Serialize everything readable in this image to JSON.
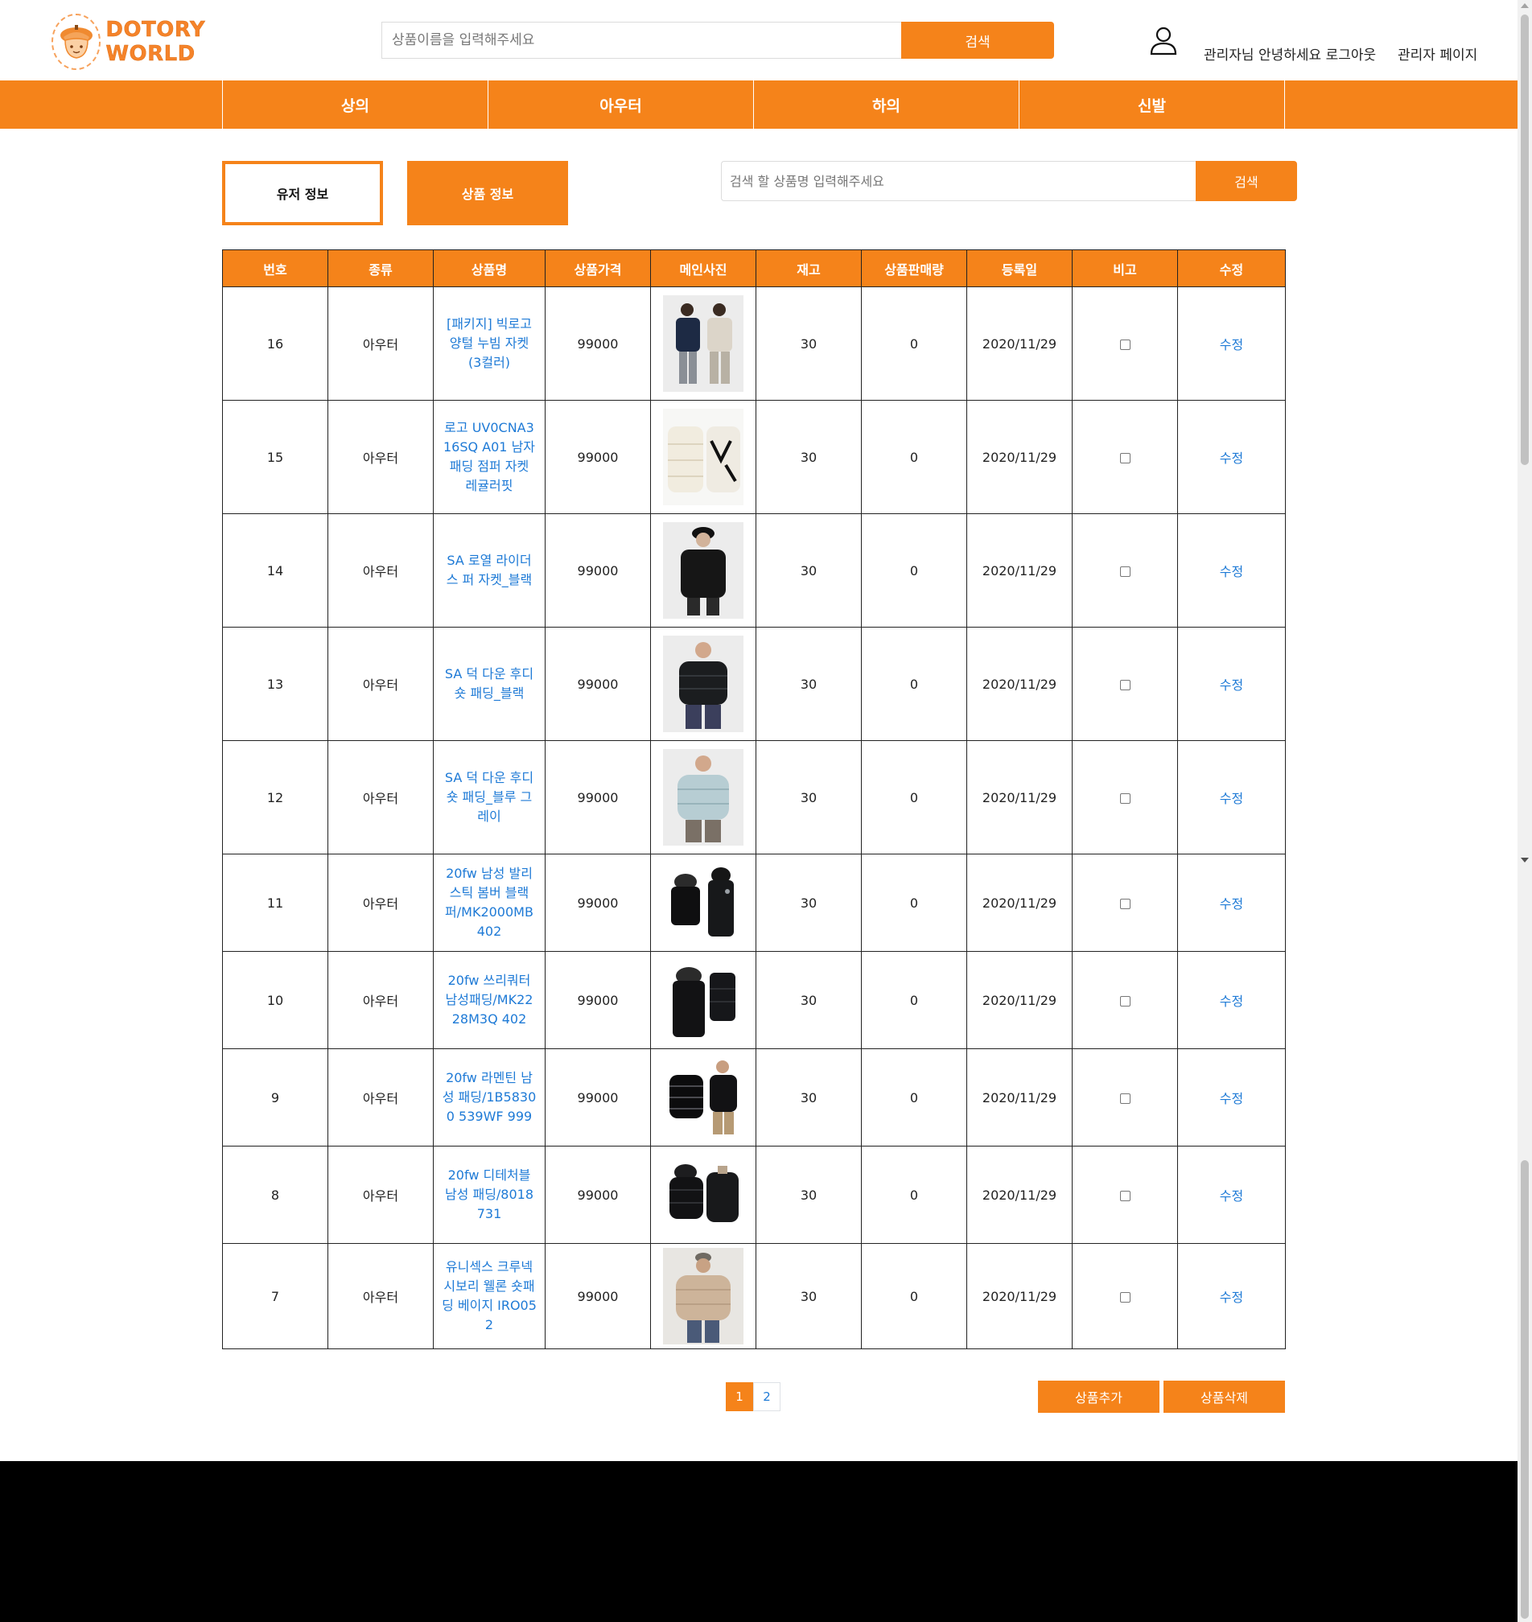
{
  "header": {
    "logo_text": "DOTORY WORLD",
    "search_placeholder": "상품이름을 입력해주세요",
    "search_button": "검색",
    "greeting": "관리자님 안녕하세요 로그아웃",
    "admin_page": "관리자 페이지"
  },
  "nav": {
    "items": [
      {
        "label": "상의"
      },
      {
        "label": "아우터"
      },
      {
        "label": "하의"
      },
      {
        "label": "신발"
      }
    ]
  },
  "tabs": {
    "user_info": "유저 정보",
    "product_info": "상품 정보"
  },
  "product_search": {
    "placeholder": "검색 할 상품명 입력해주세요",
    "button": "검색"
  },
  "table": {
    "columns": [
      "번호",
      "종류",
      "상품명",
      "상품가격",
      "메인사진",
      "재고",
      "상품판매량",
      "등록일",
      "비고",
      "수정"
    ],
    "rows": [
      {
        "no": "16",
        "type": "아우터",
        "name": "[패키지] 빅로고 양털 누빔 자켓 (3컬러)",
        "price": "99000",
        "stock": "30",
        "sales": "0",
        "date": "2020/11/29",
        "edit": "수정",
        "photo": "twin-jackets"
      },
      {
        "no": "15",
        "type": "아우터",
        "name": "로고 UV0CNA316SQ A01 남자 패딩 점퍼 자켓 레귤러핏",
        "price": "99000",
        "stock": "30",
        "sales": "0",
        "date": "2020/11/29",
        "edit": "수정",
        "photo": "white-padding"
      },
      {
        "no": "14",
        "type": "아우터",
        "name": "SA 로열 라이더스 퍼 자켓_블랙",
        "price": "99000",
        "stock": "30",
        "sales": "0",
        "date": "2020/11/29",
        "edit": "수정",
        "photo": "black-fur"
      },
      {
        "no": "13",
        "type": "아우터",
        "name": "SA 덕 다운 후디 숏 패딩_블랙",
        "price": "99000",
        "stock": "30",
        "sales": "0",
        "date": "2020/11/29",
        "edit": "수정",
        "photo": "black-hoodie-padding"
      },
      {
        "no": "12",
        "type": "아우터",
        "name": "SA 덕 다운 후디 숏 패딩_블루 그레이",
        "price": "99000",
        "stock": "30",
        "sales": "0",
        "date": "2020/11/29",
        "edit": "수정",
        "photo": "blue-grey-padding"
      },
      {
        "no": "11",
        "type": "아우터",
        "name": "20fw 남성 발리스틱 봄버 블랙 퍼/MK2000MB 402",
        "price": "99000",
        "stock": "30",
        "sales": "0",
        "date": "2020/11/29",
        "edit": "수정",
        "photo": "black-bomber"
      },
      {
        "no": "10",
        "type": "아우터",
        "name": "20fw 쓰리쿼터 남성패딩/MK2228M3Q 402",
        "price": "99000",
        "stock": "30",
        "sales": "0",
        "date": "2020/11/29",
        "edit": "수정",
        "photo": "black-three-quarter"
      },
      {
        "no": "9",
        "type": "아우터",
        "name": "20fw 라멘틴 남성 패딩/1B58300 539WF 999",
        "price": "99000",
        "stock": "30",
        "sales": "0",
        "date": "2020/11/29",
        "edit": "수정",
        "photo": "glossy-black-padding"
      },
      {
        "no": "8",
        "type": "아우터",
        "name": "20fw 디테처블 남성 패딩/8018731",
        "price": "99000",
        "stock": "30",
        "sales": "0",
        "date": "2020/11/29",
        "edit": "수정",
        "photo": "detachable-padding"
      },
      {
        "no": "7",
        "type": "아우터",
        "name": "유니섹스 크루넥 시보리 웰론 숏패딩 베이지 IRO052",
        "price": "99000",
        "stock": "30",
        "sales": "0",
        "date": "2020/11/29",
        "edit": "수정",
        "photo": "beige-padding"
      }
    ]
  },
  "pagination": {
    "pages": [
      "1",
      "2"
    ],
    "active": "1"
  },
  "actions": {
    "add": "상품추가",
    "delete": "상품삭제"
  },
  "colors": {
    "accent": "#f5831a",
    "link": "#1e7ad6",
    "footer": "#000000"
  }
}
